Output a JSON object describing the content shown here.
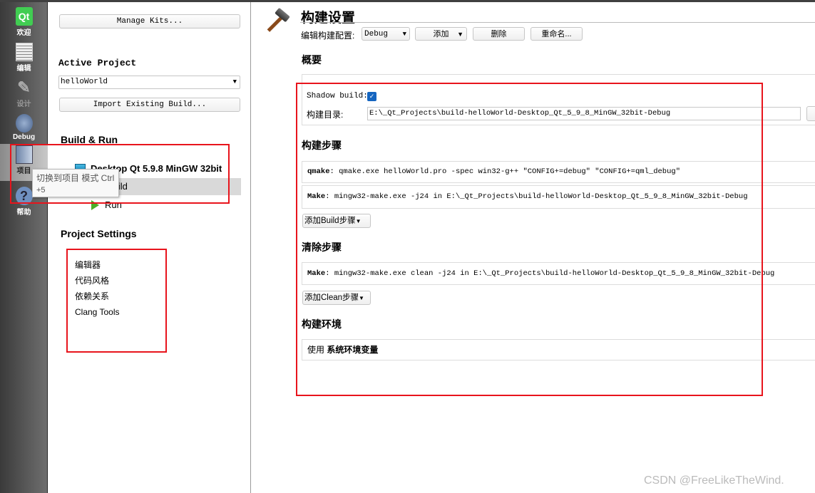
{
  "sidebar": {
    "items": [
      {
        "label": "欢迎",
        "icon": "qt-logo-icon"
      },
      {
        "label": "编辑",
        "icon": "edit-document-icon"
      },
      {
        "label": "设计",
        "icon": "design-icon"
      },
      {
        "label": "Debug",
        "icon": "bug-icon"
      },
      {
        "label": "项目",
        "icon": "project-folder-icon",
        "selected": true
      },
      {
        "label": "帮助",
        "icon": "help-icon"
      }
    ]
  },
  "tooltip": {
    "line1": "切换到项目 模式 Ctrl",
    "line2": "+5"
  },
  "middle": {
    "manage_kits": "Manage Kits...",
    "active_project_title": "Active Project",
    "active_project_value": "helloWorld",
    "import_build": "Import Existing Build...",
    "build_run_title": "Build & Run",
    "kit_name": "Desktop Qt 5.9.8 MinGW 32bit",
    "build_label": "Build",
    "run_label": "Run",
    "project_settings_title": "Project Settings",
    "settings_items": [
      "编辑器",
      "代码风格",
      "依赖关系",
      "Clang Tools"
    ]
  },
  "main": {
    "title": "构建设置",
    "edit_config_label": "编辑构建配置:",
    "config_value": "Debug",
    "add_button": "添加",
    "delete_button": "删除",
    "rename_button": "重命名...",
    "overview_title": "概要",
    "shadow_build_label": "Shadow build:",
    "shadow_build_checked": true,
    "build_dir_label": "构建目录:",
    "build_dir_value": "E:\\_Qt_Projects\\build-helloWorld-Desktop_Qt_5_9_8_MinGW_32bit-Debug",
    "build_steps_title": "构建步骤",
    "build_steps": [
      {
        "name": "qmake",
        "text": ": qmake.exe helloWorld.pro -spec win32-g++ \"CONFIG+=debug\" \"CONFIG+=qml_debug\""
      },
      {
        "name": "Make",
        "text": ": mingw32-make.exe -j24 in E:\\_Qt_Projects\\build-helloWorld-Desktop_Qt_5_9_8_MinGW_32bit-Debug"
      }
    ],
    "add_build_step": "添加Build步骤",
    "clean_steps_title": "清除步骤",
    "clean_steps": [
      {
        "name": "Make",
        "text": ": mingw32-make.exe clean -j24 in E:\\_Qt_Projects\\build-helloWorld-Desktop_Qt_5_9_8_MinGW_32bit-Debug"
      }
    ],
    "add_clean_step": "添加Clean步骤",
    "env_title": "构建环境",
    "env_use": "使用",
    "env_value": "系统环境变量"
  },
  "watermark": "CSDN @FreeLikeTheWind.",
  "colors": {
    "highlight_box": "#e8141c",
    "checkbox": "#1565c0",
    "selected_row": "#d9d9d9"
  }
}
